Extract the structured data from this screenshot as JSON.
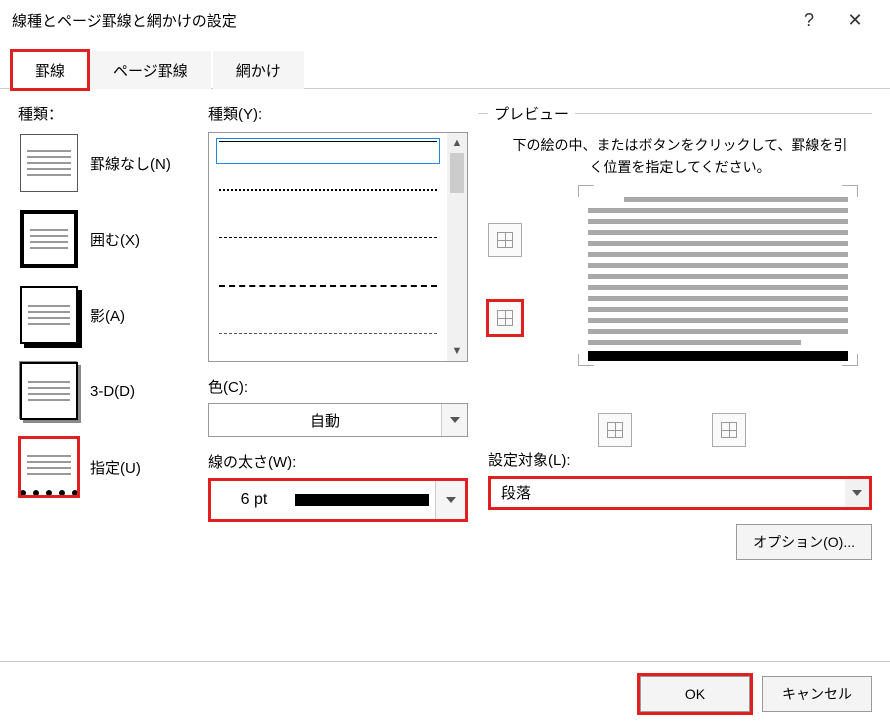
{
  "titlebar": {
    "title": "線種とページ罫線と網かけの設定",
    "help": "?",
    "close": "✕"
  },
  "tabs": {
    "borders": "罫線",
    "pageBorders": "ページ罫線",
    "shading": "網かけ"
  },
  "left": {
    "heading": "種類：",
    "none": "罫線なし(N)",
    "box": "囲む(X)",
    "shadow": "影(A)",
    "threeD": "3-D(D)",
    "custom": "指定(U)"
  },
  "mid": {
    "styleLabel": "種類(Y):",
    "colorLabel": "色(C):",
    "colorValue": "自動",
    "widthLabel": "線の太さ(W):",
    "widthValue": "6 pt"
  },
  "right": {
    "previewLegend": "プレビュー",
    "previewHelp": "下の絵の中、またはボタンをクリックして、罫線を引く位置を指定してください。",
    "applyLabel": "設定対象(L):",
    "applyValue": "段落",
    "optionsBtn": "オプション(O)..."
  },
  "footer": {
    "ok": "OK",
    "cancel": "キャンセル"
  }
}
